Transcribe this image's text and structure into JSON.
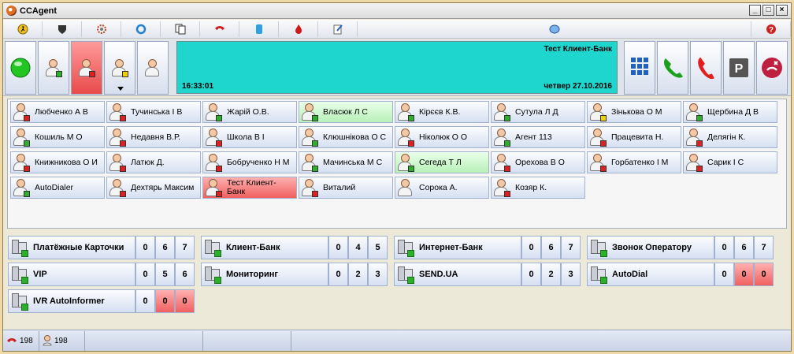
{
  "window": {
    "title": "CCAgent",
    "min_label": "_",
    "max_label": "□",
    "close_label": "×"
  },
  "toolbar": {
    "icons": [
      "walk-icon",
      "shield-icon",
      "gear-icon",
      "refresh-icon",
      "copy-icon",
      "phone-menu-icon",
      "contacts-icon",
      "flame-icon",
      "notepad-icon",
      "chat-icon",
      "help-icon"
    ]
  },
  "display": {
    "client": "Тест Клиент-Банк",
    "time": "16:33:01",
    "date": "четвер 27.10.2016"
  },
  "agents": [
    {
      "name": "Любченко А В",
      "status": "red",
      "bg": ""
    },
    {
      "name": "Тучинська І В",
      "status": "red",
      "bg": ""
    },
    {
      "name": "Жарій О.В.",
      "status": "green",
      "bg": ""
    },
    {
      "name": "Власюк Л С",
      "status": "green",
      "bg": "green"
    },
    {
      "name": "Кірєєв К.В.",
      "status": "green",
      "bg": ""
    },
    {
      "name": "Сутула Л Д",
      "status": "green",
      "bg": ""
    },
    {
      "name": "Зінькова О М",
      "status": "yellow",
      "bg": ""
    },
    {
      "name": "Щербина Д В",
      "status": "green",
      "bg": ""
    },
    {
      "name": "Кошиль М О",
      "status": "green",
      "bg": ""
    },
    {
      "name": "Недавня В.Р.",
      "status": "red",
      "bg": ""
    },
    {
      "name": "Школа В І",
      "status": "red",
      "bg": ""
    },
    {
      "name": "Клюшнікова О С",
      "status": "green",
      "bg": ""
    },
    {
      "name": "Ніколюк О О",
      "status": "red",
      "bg": ""
    },
    {
      "name": "Агент 113",
      "status": "green",
      "bg": ""
    },
    {
      "name": "Працевита Н.",
      "status": "red",
      "bg": ""
    },
    {
      "name": "Делягін К.",
      "status": "red",
      "bg": ""
    },
    {
      "name": "Книжникова О И",
      "status": "red",
      "bg": ""
    },
    {
      "name": "Латюк Д.",
      "status": "red",
      "bg": ""
    },
    {
      "name": "Бобрученко Н М",
      "status": "red",
      "bg": ""
    },
    {
      "name": "Мачинська М С",
      "status": "green",
      "bg": ""
    },
    {
      "name": "Сегеда Т Л",
      "status": "green",
      "bg": "green"
    },
    {
      "name": "Орехова В О",
      "status": "red",
      "bg": ""
    },
    {
      "name": "Горбатенко І М",
      "status": "red",
      "bg": ""
    },
    {
      "name": "Сарик І С",
      "status": "red",
      "bg": ""
    },
    {
      "name": "AutoDialer",
      "status": "green",
      "bg": ""
    },
    {
      "name": "Дехтярь Максим",
      "status": "red",
      "bg": ""
    },
    {
      "name": "Тест Клиент-Банк",
      "status": "red",
      "bg": "red"
    },
    {
      "name": "Виталий",
      "status": "red",
      "bg": ""
    },
    {
      "name": "Сорока А.",
      "status": "none",
      "bg": ""
    },
    {
      "name": "Козяр К.",
      "status": "red",
      "bg": ""
    }
  ],
  "queues": [
    {
      "name": "Платёжные Карточки",
      "v": [
        "0",
        "6",
        "7"
      ],
      "red": [
        false,
        false,
        false
      ]
    },
    {
      "name": "Клиент-Банк",
      "v": [
        "0",
        "4",
        "5"
      ],
      "red": [
        false,
        false,
        false
      ]
    },
    {
      "name": "Интернет-Банк",
      "v": [
        "0",
        "6",
        "7"
      ],
      "red": [
        false,
        false,
        false
      ]
    },
    {
      "name": "Звонок Оператору",
      "v": [
        "0",
        "6",
        "7"
      ],
      "red": [
        false,
        false,
        false
      ]
    },
    {
      "name": "VIP",
      "v": [
        "0",
        "5",
        "6"
      ],
      "red": [
        false,
        false,
        false
      ]
    },
    {
      "name": "Мониторинг",
      "v": [
        "0",
        "2",
        "3"
      ],
      "red": [
        false,
        false,
        false
      ]
    },
    {
      "name": "SEND.UA",
      "v": [
        "0",
        "2",
        "3"
      ],
      "red": [
        false,
        false,
        false
      ]
    },
    {
      "name": "AutoDial",
      "v": [
        "0",
        "0",
        "0"
      ],
      "red": [
        false,
        true,
        true
      ]
    },
    {
      "name": "IVR AutoInformer",
      "v": [
        "0",
        "0",
        "0"
      ],
      "red": [
        false,
        true,
        true
      ]
    }
  ],
  "statusbar": {
    "calls": "198",
    "agents": "198"
  },
  "colors": {
    "display": "#1fd6cf",
    "green_status": "#2cb02c",
    "red_status": "#e02020",
    "yellow_status": "#f0d000"
  }
}
